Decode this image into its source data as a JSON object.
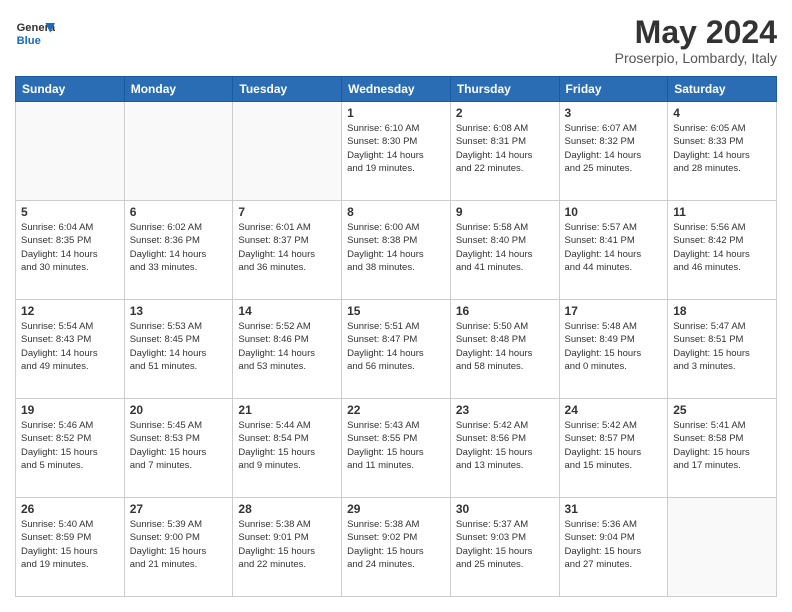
{
  "header": {
    "logo_general": "General",
    "logo_blue": "Blue",
    "title": "May 2024",
    "subtitle": "Proserpio, Lombardy, Italy"
  },
  "days_of_week": [
    "Sunday",
    "Monday",
    "Tuesday",
    "Wednesday",
    "Thursday",
    "Friday",
    "Saturday"
  ],
  "weeks": [
    [
      {
        "day": "",
        "info": ""
      },
      {
        "day": "",
        "info": ""
      },
      {
        "day": "",
        "info": ""
      },
      {
        "day": "1",
        "info": "Sunrise: 6:10 AM\nSunset: 8:30 PM\nDaylight: 14 hours\nand 19 minutes."
      },
      {
        "day": "2",
        "info": "Sunrise: 6:08 AM\nSunset: 8:31 PM\nDaylight: 14 hours\nand 22 minutes."
      },
      {
        "day": "3",
        "info": "Sunrise: 6:07 AM\nSunset: 8:32 PM\nDaylight: 14 hours\nand 25 minutes."
      },
      {
        "day": "4",
        "info": "Sunrise: 6:05 AM\nSunset: 8:33 PM\nDaylight: 14 hours\nand 28 minutes."
      }
    ],
    [
      {
        "day": "5",
        "info": "Sunrise: 6:04 AM\nSunset: 8:35 PM\nDaylight: 14 hours\nand 30 minutes."
      },
      {
        "day": "6",
        "info": "Sunrise: 6:02 AM\nSunset: 8:36 PM\nDaylight: 14 hours\nand 33 minutes."
      },
      {
        "day": "7",
        "info": "Sunrise: 6:01 AM\nSunset: 8:37 PM\nDaylight: 14 hours\nand 36 minutes."
      },
      {
        "day": "8",
        "info": "Sunrise: 6:00 AM\nSunset: 8:38 PM\nDaylight: 14 hours\nand 38 minutes."
      },
      {
        "day": "9",
        "info": "Sunrise: 5:58 AM\nSunset: 8:40 PM\nDaylight: 14 hours\nand 41 minutes."
      },
      {
        "day": "10",
        "info": "Sunrise: 5:57 AM\nSunset: 8:41 PM\nDaylight: 14 hours\nand 44 minutes."
      },
      {
        "day": "11",
        "info": "Sunrise: 5:56 AM\nSunset: 8:42 PM\nDaylight: 14 hours\nand 46 minutes."
      }
    ],
    [
      {
        "day": "12",
        "info": "Sunrise: 5:54 AM\nSunset: 8:43 PM\nDaylight: 14 hours\nand 49 minutes."
      },
      {
        "day": "13",
        "info": "Sunrise: 5:53 AM\nSunset: 8:45 PM\nDaylight: 14 hours\nand 51 minutes."
      },
      {
        "day": "14",
        "info": "Sunrise: 5:52 AM\nSunset: 8:46 PM\nDaylight: 14 hours\nand 53 minutes."
      },
      {
        "day": "15",
        "info": "Sunrise: 5:51 AM\nSunset: 8:47 PM\nDaylight: 14 hours\nand 56 minutes."
      },
      {
        "day": "16",
        "info": "Sunrise: 5:50 AM\nSunset: 8:48 PM\nDaylight: 14 hours\nand 58 minutes."
      },
      {
        "day": "17",
        "info": "Sunrise: 5:48 AM\nSunset: 8:49 PM\nDaylight: 15 hours\nand 0 minutes."
      },
      {
        "day": "18",
        "info": "Sunrise: 5:47 AM\nSunset: 8:51 PM\nDaylight: 15 hours\nand 3 minutes."
      }
    ],
    [
      {
        "day": "19",
        "info": "Sunrise: 5:46 AM\nSunset: 8:52 PM\nDaylight: 15 hours\nand 5 minutes."
      },
      {
        "day": "20",
        "info": "Sunrise: 5:45 AM\nSunset: 8:53 PM\nDaylight: 15 hours\nand 7 minutes."
      },
      {
        "day": "21",
        "info": "Sunrise: 5:44 AM\nSunset: 8:54 PM\nDaylight: 15 hours\nand 9 minutes."
      },
      {
        "day": "22",
        "info": "Sunrise: 5:43 AM\nSunset: 8:55 PM\nDaylight: 15 hours\nand 11 minutes."
      },
      {
        "day": "23",
        "info": "Sunrise: 5:42 AM\nSunset: 8:56 PM\nDaylight: 15 hours\nand 13 minutes."
      },
      {
        "day": "24",
        "info": "Sunrise: 5:42 AM\nSunset: 8:57 PM\nDaylight: 15 hours\nand 15 minutes."
      },
      {
        "day": "25",
        "info": "Sunrise: 5:41 AM\nSunset: 8:58 PM\nDaylight: 15 hours\nand 17 minutes."
      }
    ],
    [
      {
        "day": "26",
        "info": "Sunrise: 5:40 AM\nSunset: 8:59 PM\nDaylight: 15 hours\nand 19 minutes."
      },
      {
        "day": "27",
        "info": "Sunrise: 5:39 AM\nSunset: 9:00 PM\nDaylight: 15 hours\nand 21 minutes."
      },
      {
        "day": "28",
        "info": "Sunrise: 5:38 AM\nSunset: 9:01 PM\nDaylight: 15 hours\nand 22 minutes."
      },
      {
        "day": "29",
        "info": "Sunrise: 5:38 AM\nSunset: 9:02 PM\nDaylight: 15 hours\nand 24 minutes."
      },
      {
        "day": "30",
        "info": "Sunrise: 5:37 AM\nSunset: 9:03 PM\nDaylight: 15 hours\nand 25 minutes."
      },
      {
        "day": "31",
        "info": "Sunrise: 5:36 AM\nSunset: 9:04 PM\nDaylight: 15 hours\nand 27 minutes."
      },
      {
        "day": "",
        "info": ""
      }
    ]
  ]
}
